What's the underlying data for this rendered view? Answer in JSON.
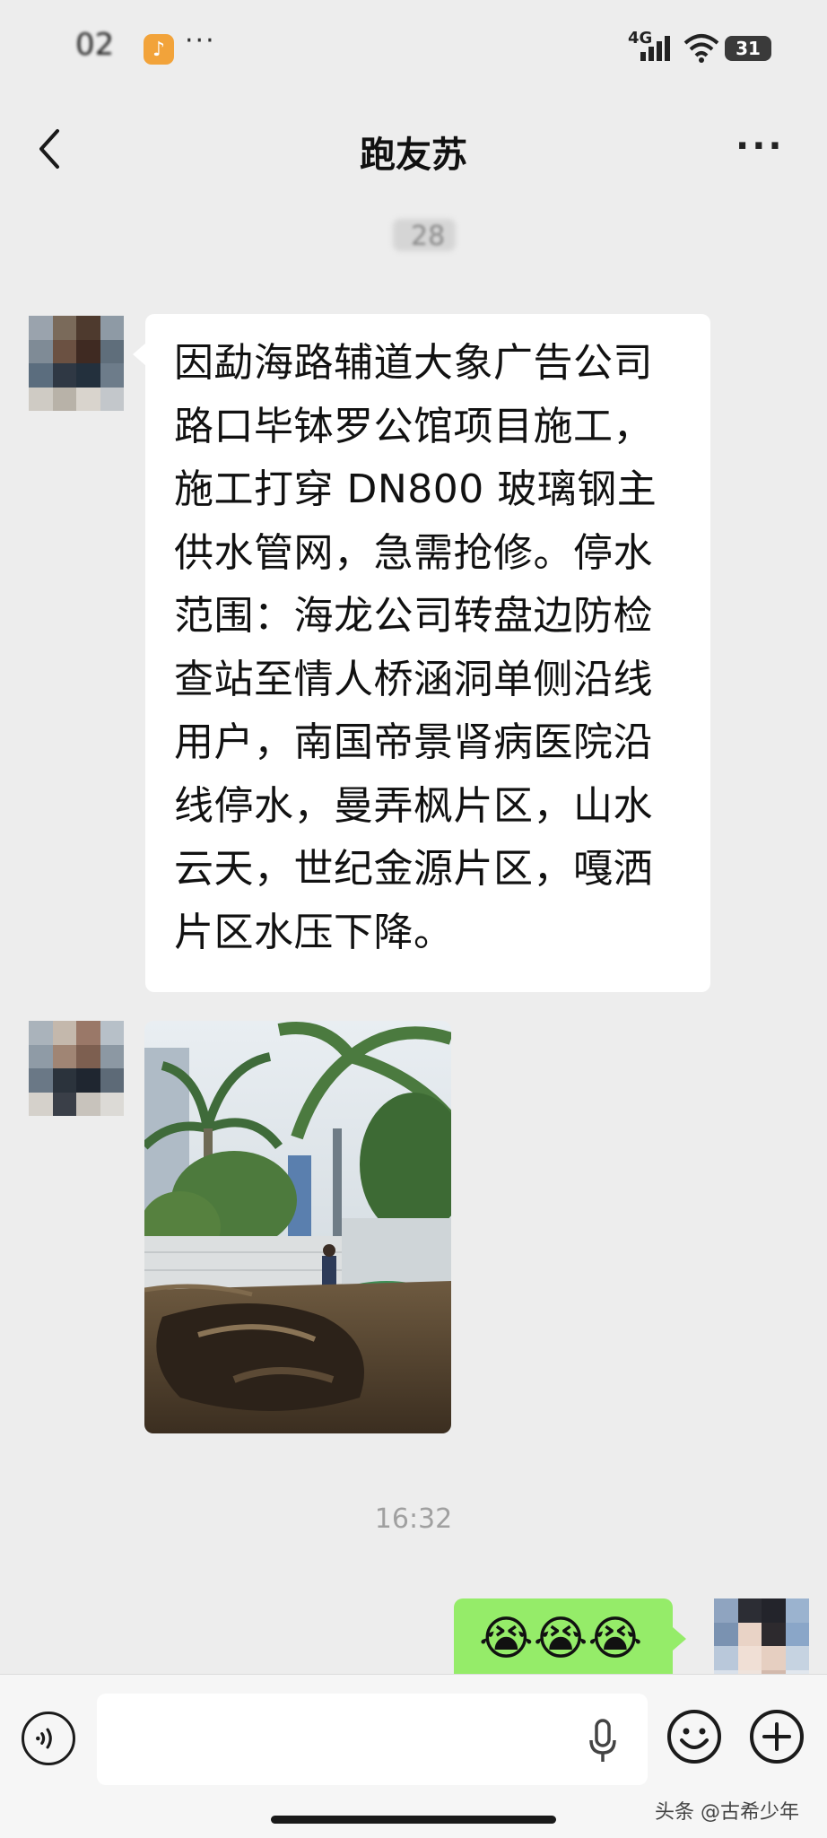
{
  "status_bar": {
    "time": "02",
    "network": "4G",
    "battery": "31",
    "more": "···"
  },
  "nav": {
    "title": "跑友苏"
  },
  "messages": {
    "first_timestamp": "28",
    "text": "因勐海路辅道大象广告公司路口毕钵罗公馆项目施工，施工打穿 DN800 玻璃钢主供水管网，急需抢修。停水范围：海龙公司转盘边防检查站至情人桥涵洞单侧沿线用户，南国帝景肾病医院沿线停水，曼弄枫片区，山水云天，世纪金源片区，嘎洒片区水压下降。",
    "timestamp": "16:32",
    "outgoing": "😭😭😭"
  },
  "watermark": "头条 @古希少年",
  "colors": {
    "background": "#ededed",
    "bubble_incoming": "#ffffff",
    "bubble_outgoing": "#95ec69"
  },
  "icons": [
    "back-icon",
    "more-icon",
    "voice-icon",
    "mic-icon",
    "emoji-icon",
    "plus-icon"
  ]
}
